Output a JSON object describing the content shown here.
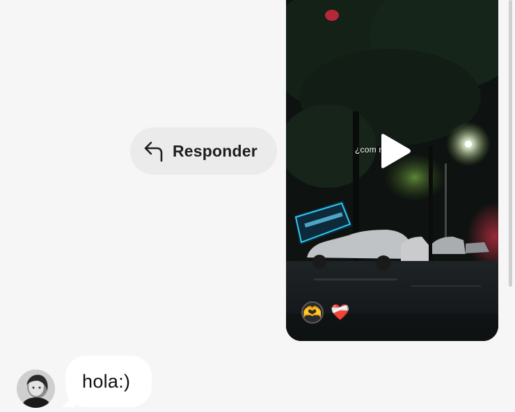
{
  "reply_action": {
    "label": "Responder",
    "icon": "reply-arrow-icon"
  },
  "video_message": {
    "caption": "¿com            nas?",
    "play_icon": "play-icon",
    "reactions": [
      {
        "emoji": "🫶",
        "icon": "heart-hands-reaction"
      },
      {
        "emoji": "❤️‍🩹",
        "icon": "mending-heart-reaction"
      }
    ]
  },
  "incoming_message": {
    "text": "hola:)",
    "avatar_icon": "user-avatar"
  },
  "colors": {
    "background": "#f6f6f6",
    "reply_pill": "#ebebeb",
    "bubble": "#ffffff",
    "text": "#111111"
  }
}
